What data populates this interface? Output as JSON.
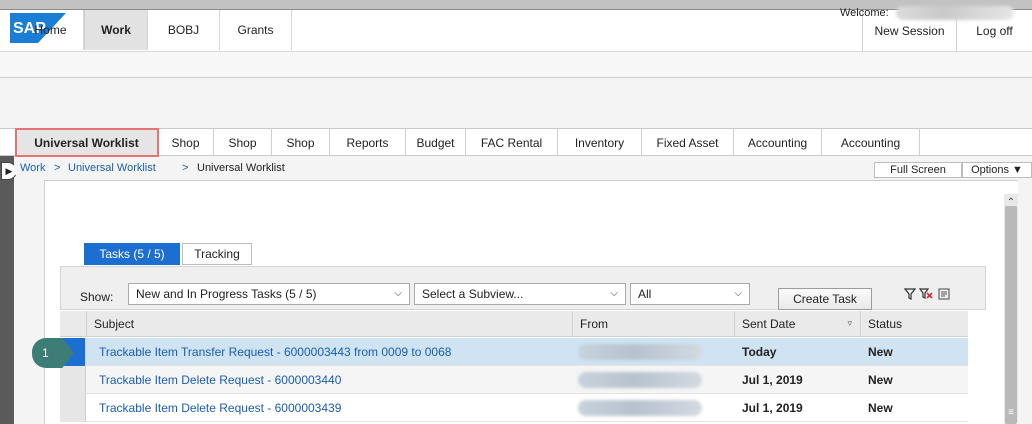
{
  "header": {
    "new_session": "New Session",
    "log_off": "Log off",
    "welcome": "Welcome:"
  },
  "top_tabs": [
    {
      "label": "Home"
    },
    {
      "label": "Work"
    },
    {
      "label": "BOBJ"
    },
    {
      "label": "Grants"
    }
  ],
  "sub_tabs": [
    {
      "label": "Universal Worklist"
    },
    {
      "label": "Shop"
    },
    {
      "label": "Shop"
    },
    {
      "label": "Shop"
    },
    {
      "label": "Reports"
    },
    {
      "label": "Budget"
    },
    {
      "label": "FAC Rental"
    },
    {
      "label": "Inventory"
    },
    {
      "label": "Fixed Asset"
    },
    {
      "label": "Accounting"
    },
    {
      "label": "Accounting"
    }
  ],
  "breadcrumb": {
    "items": [
      "Work",
      "Universal Worklist",
      "Universal Worklist"
    ],
    "separator": ">"
  },
  "page_actions": {
    "full_screen": "Full Screen",
    "options": "Options ▼"
  },
  "worklist": {
    "tabs": [
      {
        "label": "Tasks  (5 / 5)"
      },
      {
        "label": "Tracking"
      }
    ],
    "show_label": "Show:",
    "show_select": "New and In Progress Tasks  (5 / 5)",
    "subview_select": "Select a Subview...",
    "all_select": "All",
    "create_task": "Create Task",
    "columns": [
      "Subject",
      "From",
      "Sent Date",
      "Status"
    ],
    "rows": [
      {
        "subject": "Trackable Item Transfer Request - 6000003443 from 0009 to 0068",
        "sent_date": "Today",
        "status": "New"
      },
      {
        "subject": "Trackable Item Delete Request - 6000003440",
        "sent_date": "Jul 1, 2019",
        "status": "New"
      },
      {
        "subject": "Trackable Item Delete Request - 6000003439",
        "sent_date": "Jul 1, 2019",
        "status": "New"
      }
    ]
  },
  "callout": "1",
  "icons": {
    "filter": "filter-icon",
    "clear_filter": "clear-filter-icon",
    "settings": "table-settings-icon"
  },
  "colors": {
    "accent": "#1c6fd1",
    "selected_row": "#cfe3f3",
    "highlight_outline": "#e57373",
    "badge": "#3d7d77",
    "link": "#1a5db3"
  }
}
